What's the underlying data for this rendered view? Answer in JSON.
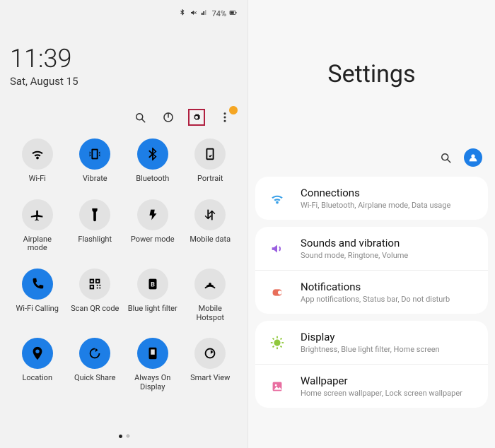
{
  "status": {
    "battery_text": "74%"
  },
  "clock": {
    "time": "11:39",
    "date": "Sat, August 15"
  },
  "grid": [
    {
      "key": "wifi",
      "label": "Wi-Fi",
      "active": false,
      "icon": "wifi"
    },
    {
      "key": "vibrate",
      "label": "Vibrate",
      "active": true,
      "icon": "vibrate"
    },
    {
      "key": "bluetooth",
      "label": "Bluetooth",
      "active": true,
      "icon": "bluetooth"
    },
    {
      "key": "portrait",
      "label": "Portrait",
      "active": false,
      "icon": "portrait"
    },
    {
      "key": "airplane",
      "label": "Airplane mode",
      "active": false,
      "icon": "airplane"
    },
    {
      "key": "flashlight",
      "label": "Flashlight",
      "active": false,
      "icon": "flashlight"
    },
    {
      "key": "powermode",
      "label": "Power mode",
      "active": false,
      "icon": "powermode"
    },
    {
      "key": "mobiledata",
      "label": "Mobile data",
      "active": false,
      "icon": "mobiledata"
    },
    {
      "key": "wificalling",
      "label": "Wi-Fi Calling",
      "active": true,
      "icon": "wificalling"
    },
    {
      "key": "scanqr",
      "label": "Scan QR code",
      "active": false,
      "icon": "scanqr"
    },
    {
      "key": "bluelight",
      "label": "Blue light filter",
      "active": false,
      "icon": "bluelight"
    },
    {
      "key": "hotspot",
      "label": "Mobile Hotspot",
      "active": false,
      "icon": "hotspot"
    },
    {
      "key": "location",
      "label": "Location",
      "active": true,
      "icon": "location"
    },
    {
      "key": "quickshare",
      "label": "Quick Share",
      "active": true,
      "icon": "quickshare"
    },
    {
      "key": "aod",
      "label": "Always On Display",
      "active": true,
      "icon": "aod"
    },
    {
      "key": "smartview",
      "label": "Smart View",
      "active": false,
      "icon": "smartview"
    }
  ],
  "settings": {
    "title": "Settings",
    "groups": [
      {
        "items": [
          {
            "key": "connections",
            "title": "Connections",
            "sub": "Wi-Fi, Bluetooth, Airplane mode, Data usage",
            "color": "#3aa0e8",
            "icon": "wifi"
          }
        ]
      },
      {
        "items": [
          {
            "key": "sounds",
            "title": "Sounds and vibration",
            "sub": "Sound mode, Ringtone, Volume",
            "color": "#9a5fe0",
            "icon": "sound"
          },
          {
            "key": "notifications",
            "title": "Notifications",
            "sub": "App notifications, Status bar, Do not disturb",
            "color": "#e86e5a",
            "icon": "notif"
          }
        ]
      },
      {
        "items": [
          {
            "key": "display",
            "title": "Display",
            "sub": "Brightness, Blue light filter, Home screen",
            "color": "#90c83c",
            "icon": "display"
          },
          {
            "key": "wallpaper",
            "title": "Wallpaper",
            "sub": "Home screen wallpaper, Lock screen wallpaper",
            "color": "#e86ea0",
            "icon": "wallpaper"
          }
        ]
      }
    ]
  }
}
